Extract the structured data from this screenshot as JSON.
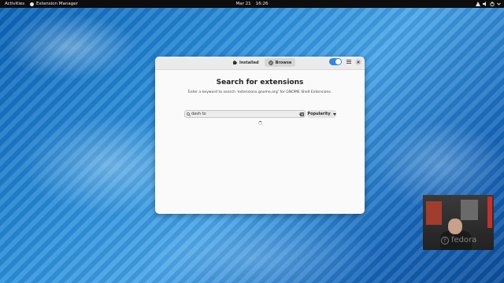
{
  "topbar": {
    "activities": "Activities",
    "app_name": "Extension Manager",
    "date": "Mar 21",
    "time": "16:26"
  },
  "window": {
    "tabs": [
      {
        "label": "Installed",
        "icon": "puzzle-icon",
        "active": false
      },
      {
        "label": "Browse",
        "icon": "globe-icon",
        "active": true
      }
    ],
    "title": "Search for extensions",
    "subtitle": "Enter a keyword to search 'extensions.gnome.org' for GNOME Shell Extensions.",
    "search": {
      "value": "dash to",
      "placeholder": ""
    },
    "sort": {
      "label": "Popularity"
    },
    "toggle_on": true
  },
  "watermark": {
    "text": "fedora"
  },
  "colors": {
    "accent": "#3584e4",
    "window_bg": "#fafafa",
    "topbar": "#0d0d0d"
  }
}
